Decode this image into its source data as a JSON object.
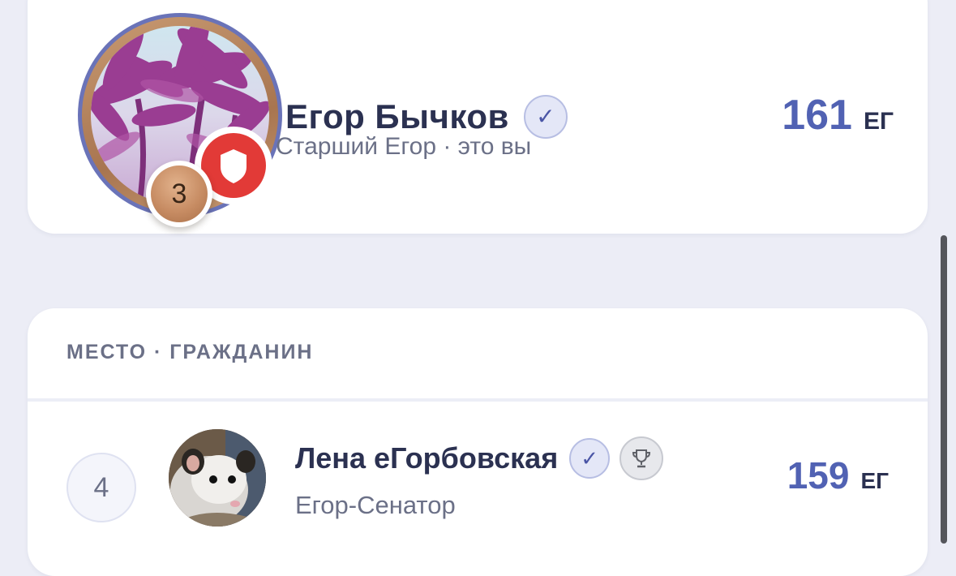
{
  "current_user": {
    "name": "Егор Бычков",
    "verified_icon": "✓",
    "subtitle": "Старший Егор · это вы",
    "rank": "3",
    "score": "161",
    "unit": "ЕГ",
    "avatar_icon": "palm-trees-photo",
    "badge_icon": "shield-icon"
  },
  "leaderboard": {
    "header": "МЕСТО · ГРАЖДАНИН",
    "rows": [
      {
        "rank": "4",
        "name": "Лена еГорбовская",
        "verified_icon": "✓",
        "trophy_icon": "trophy-icon",
        "subtitle": "Егор-Сенатор",
        "score": "159",
        "unit": "ЕГ",
        "avatar_icon": "opossum-photo"
      }
    ]
  },
  "colors": {
    "background": "#ecedf6",
    "card": "#ffffff",
    "accent": "#5162b3",
    "text_dark": "#2b3151",
    "text_muted": "#6b7087",
    "shield_red": "#e23a37",
    "bronze": "#c78c63"
  }
}
